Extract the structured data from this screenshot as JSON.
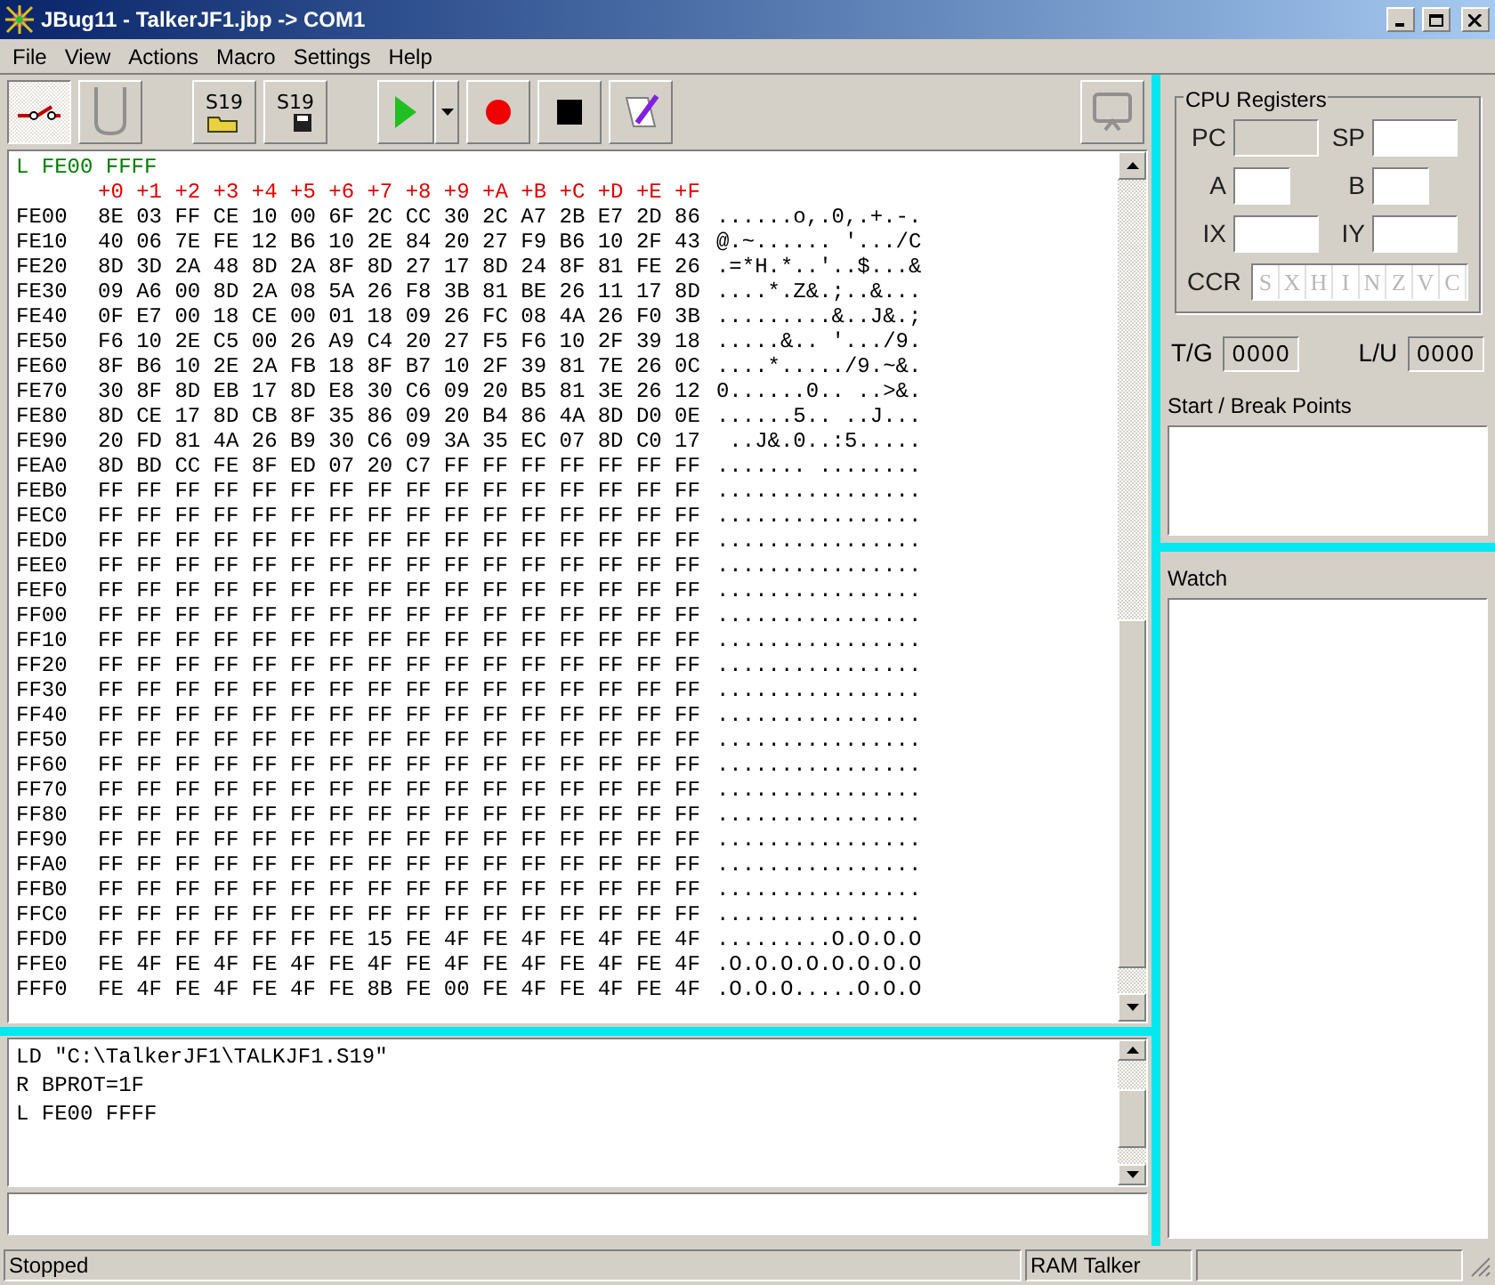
{
  "window": {
    "title": "JBug11 - TalkerJF1.jbp -> COM1"
  },
  "menu": [
    "File",
    "View",
    "Actions",
    "Macro",
    "Settings",
    "Help"
  ],
  "toolbar": {
    "mode_buttons": [
      {
        "kind": "link",
        "selected": true
      },
      {
        "kind": "unlink",
        "selected": false
      }
    ],
    "file_buttons": [
      {
        "kind": "load",
        "label": "S19"
      },
      {
        "kind": "save",
        "label": "S19"
      }
    ]
  },
  "memory_view": {
    "command": "L FE00 FFFF",
    "offsets": "+0 +1 +2 +3 +4 +5 +6 +7 +8 +9 +A +B +C +D +E +F",
    "rows": [
      {
        "address": "FE00",
        "bytes": "8E 03 FF CE 10 00 6F 2C CC 30 2C A7 2B E7 2D 86",
        "ascii": "......o,.0,.+.-."
      },
      {
        "address": "FE10",
        "bytes": "40 06 7E FE 12 B6 10 2E 84 20 27 F9 B6 10 2F 43",
        "ascii": "@.~...... '.../C"
      },
      {
        "address": "FE20",
        "bytes": "8D 3D 2A 48 8D 2A 8F 8D 27 17 8D 24 8F 81 FE 26",
        "ascii": ".=*H.*..'..$...&"
      },
      {
        "address": "FE30",
        "bytes": "09 A6 00 8D 2A 08 5A 26 F8 3B 81 BE 26 11 17 8D",
        "ascii": "....*.Z&.;..&..."
      },
      {
        "address": "FE40",
        "bytes": "0F E7 00 18 CE 00 01 18 09 26 FC 08 4A 26 F0 3B",
        "ascii": ".........&..J&.;"
      },
      {
        "address": "FE50",
        "bytes": "F6 10 2E C5 00 26 A9 C4 20 27 F5 F6 10 2F 39 18",
        "ascii": ".....&.. '.../9."
      },
      {
        "address": "FE60",
        "bytes": "8F B6 10 2E 2A FB 18 8F B7 10 2F 39 81 7E 26 0C",
        "ascii": "....*...../9.~&."
      },
      {
        "address": "FE70",
        "bytes": "30 8F 8D EB 17 8D E8 30 C6 09 20 B5 81 3E 26 12",
        "ascii": "0......0.. ..>&."
      },
      {
        "address": "FE80",
        "bytes": "8D CE 17 8D CB 8F 35 86 09 20 B4 86 4A 8D D0 0E",
        "ascii": "......5.. ..J..."
      },
      {
        "address": "FE90",
        "bytes": "20 FD 81 4A 26 B9 30 C6 09 3A 35 EC 07 8D C0 17",
        "ascii": " ..J&.0..:5....."
      },
      {
        "address": "FEA0",
        "bytes": "8D BD CC FE 8F ED 07 20 C7 FF FF FF FF FF FF FF",
        "ascii": "....... ........"
      },
      {
        "address": "FEB0",
        "bytes": "FF FF FF FF FF FF FF FF FF FF FF FF FF FF FF FF",
        "ascii": "................"
      },
      {
        "address": "FEC0",
        "bytes": "FF FF FF FF FF FF FF FF FF FF FF FF FF FF FF FF",
        "ascii": "................"
      },
      {
        "address": "FED0",
        "bytes": "FF FF FF FF FF FF FF FF FF FF FF FF FF FF FF FF",
        "ascii": "................"
      },
      {
        "address": "FEE0",
        "bytes": "FF FF FF FF FF FF FF FF FF FF FF FF FF FF FF FF",
        "ascii": "................"
      },
      {
        "address": "FEF0",
        "bytes": "FF FF FF FF FF FF FF FF FF FF FF FF FF FF FF FF",
        "ascii": "................"
      },
      {
        "address": "FF00",
        "bytes": "FF FF FF FF FF FF FF FF FF FF FF FF FF FF FF FF",
        "ascii": "................"
      },
      {
        "address": "FF10",
        "bytes": "FF FF FF FF FF FF FF FF FF FF FF FF FF FF FF FF",
        "ascii": "................"
      },
      {
        "address": "FF20",
        "bytes": "FF FF FF FF FF FF FF FF FF FF FF FF FF FF FF FF",
        "ascii": "................"
      },
      {
        "address": "FF30",
        "bytes": "FF FF FF FF FF FF FF FF FF FF FF FF FF FF FF FF",
        "ascii": "................"
      },
      {
        "address": "FF40",
        "bytes": "FF FF FF FF FF FF FF FF FF FF FF FF FF FF FF FF",
        "ascii": "................"
      },
      {
        "address": "FF50",
        "bytes": "FF FF FF FF FF FF FF FF FF FF FF FF FF FF FF FF",
        "ascii": "................"
      },
      {
        "address": "FF60",
        "bytes": "FF FF FF FF FF FF FF FF FF FF FF FF FF FF FF FF",
        "ascii": "................"
      },
      {
        "address": "FF70",
        "bytes": "FF FF FF FF FF FF FF FF FF FF FF FF FF FF FF FF",
        "ascii": "................"
      },
      {
        "address": "FF80",
        "bytes": "FF FF FF FF FF FF FF FF FF FF FF FF FF FF FF FF",
        "ascii": "................"
      },
      {
        "address": "FF90",
        "bytes": "FF FF FF FF FF FF FF FF FF FF FF FF FF FF FF FF",
        "ascii": "................"
      },
      {
        "address": "FFA0",
        "bytes": "FF FF FF FF FF FF FF FF FF FF FF FF FF FF FF FF",
        "ascii": "................"
      },
      {
        "address": "FFB0",
        "bytes": "FF FF FF FF FF FF FF FF FF FF FF FF FF FF FF FF",
        "ascii": "................"
      },
      {
        "address": "FFC0",
        "bytes": "FF FF FF FF FF FF FF FF FF FF FF FF FF FF FF FF",
        "ascii": "................"
      },
      {
        "address": "FFD0",
        "bytes": "FF FF FF FF FF FF FE 15 FE 4F FE 4F FE 4F FE 4F",
        "ascii": ".........O.O.O.O"
      },
      {
        "address": "FFE0",
        "bytes": "FE 4F FE 4F FE 4F FE 4F FE 4F FE 4F FE 4F FE 4F",
        "ascii": ".O.O.O.O.O.O.O.O"
      },
      {
        "address": "FFF0",
        "bytes": "FE 4F FE 4F FE 4F FE 8B FE 00 FE 4F FE 4F FE 4F",
        "ascii": ".O.O.O.....O.O.O"
      }
    ]
  },
  "command_log": [
    "LD \"C:\\TalkerJF1\\TALKJF1.S19\"",
    "R BPROT=1F",
    "L FE00 FFFF"
  ],
  "cpu_registers": {
    "title": "CPU Registers",
    "registers": [
      {
        "label": "PC",
        "kind": "word",
        "disabled": true
      },
      {
        "label": "SP",
        "kind": "word",
        "disabled": false
      },
      {
        "label": "A",
        "kind": "byte",
        "disabled": false
      },
      {
        "label": "B",
        "kind": "byte",
        "disabled": false
      },
      {
        "label": "IX",
        "kind": "word",
        "disabled": false
      },
      {
        "label": "IY",
        "kind": "word",
        "disabled": false
      }
    ],
    "ccr_label": "CCR",
    "ccr_flags": [
      {
        "label": "S",
        "disabled": true
      },
      {
        "label": "X",
        "disabled": true
      },
      {
        "label": "H",
        "disabled": true
      },
      {
        "label": "I",
        "disabled": true
      },
      {
        "label": "N",
        "disabled": true
      },
      {
        "label": "Z",
        "disabled": true
      },
      {
        "label": "V",
        "disabled": true
      },
      {
        "label": "C",
        "disabled": true
      }
    ]
  },
  "counters": [
    {
      "label": "T/G",
      "value": "0000"
    },
    {
      "label": "L/U",
      "value": "0000"
    }
  ],
  "breakpoints": {
    "label": "Start / Break Points"
  },
  "watch": {
    "label": "Watch"
  },
  "status_bar": {
    "state": "Stopped",
    "target": "RAM Talker"
  }
}
